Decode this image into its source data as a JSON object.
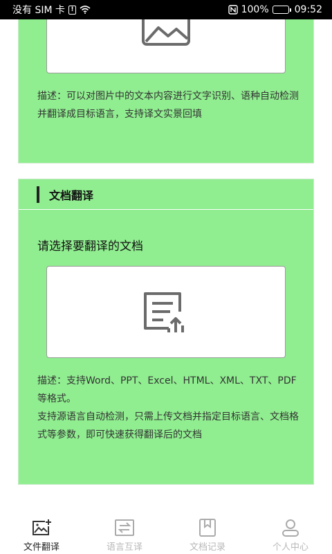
{
  "status_bar": {
    "carrier": "没有 SIM 卡",
    "battery": "100%",
    "time": "09:52",
    "battery_level": 1.0
  },
  "image_section": {
    "description": "描述：可以对图片中的文本内容进行文字识别、语种自动检测并翻译成目标语言，支持译文实景回填"
  },
  "doc_section": {
    "title": "文档翻译",
    "prompt": "请选择要翻译的文档",
    "description_line1": "描述：支持Word、PPT、Excel、HTML、XML、TXT、PDF等格式。",
    "description_line2": "支持源语言自动检测，只需上传文档并指定目标语言、文档格式等参数，即可快速获得翻译后的文档"
  },
  "tabs": [
    {
      "label": "文件翻译",
      "icon": "image-plus-icon",
      "active": true
    },
    {
      "label": "语言互译",
      "icon": "swap-icon",
      "active": false
    },
    {
      "label": "文档记录",
      "icon": "bookmark-icon",
      "active": false
    },
    {
      "label": "个人中心",
      "icon": "person-icon",
      "active": false
    }
  ],
  "colors": {
    "card_bg": "#90ee90",
    "active_tab": "#222222",
    "inactive_tab": "#b8b8b8"
  }
}
